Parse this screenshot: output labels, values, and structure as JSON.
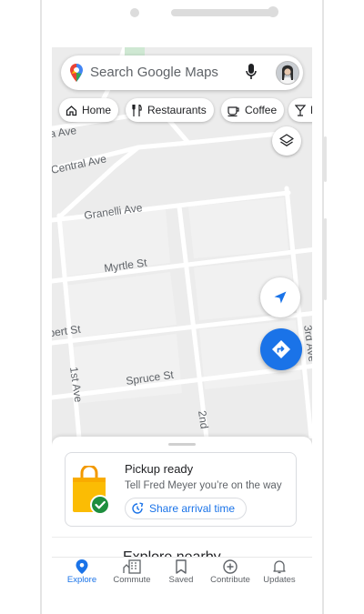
{
  "search": {
    "placeholder": "Search Google Maps"
  },
  "chips": [
    {
      "label": "Home",
      "icon": "home-icon"
    },
    {
      "label": "Restaurants",
      "icon": "restaurant-icon"
    },
    {
      "label": "Coffee",
      "icon": "coffee-icon"
    },
    {
      "label": "B",
      "icon": "bar-icon"
    }
  ],
  "map": {
    "streets": [
      "a Ave",
      "Central Ave",
      "Granelli Ave",
      "Myrtle St",
      "bert St",
      "Spruce St",
      "1st Ave",
      "2nd",
      "3rd Ave"
    ]
  },
  "card": {
    "title": "Pickup ready",
    "subtitle": "Tell Fred Meyer you’re on the way",
    "share_label": "Share arrival time"
  },
  "explore_heading": "Explore nearby",
  "nav": [
    {
      "label": "Explore",
      "icon": "explore-pin-icon",
      "active": true
    },
    {
      "label": "Commute",
      "icon": "commute-icon",
      "active": false
    },
    {
      "label": "Saved",
      "icon": "bookmark-icon",
      "active": false
    },
    {
      "label": "Contribute",
      "icon": "add-circle-icon",
      "active": false
    },
    {
      "label": "Updates",
      "icon": "bell-icon",
      "active": false
    }
  ],
  "colors": {
    "accent": "#1a73e8",
    "map_background": "#ececec",
    "road": "#ffffff",
    "success": "#1e8e3e",
    "bag": "#fbbc04"
  }
}
